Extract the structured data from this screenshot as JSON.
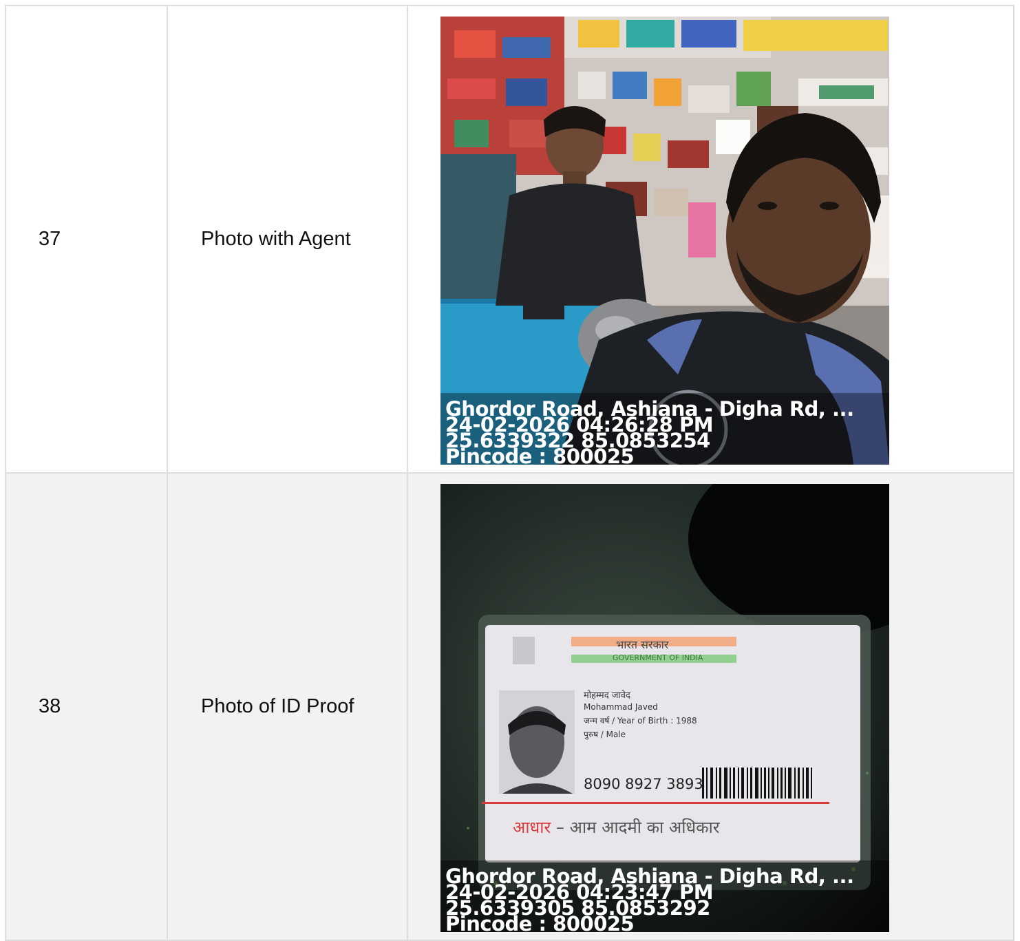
{
  "rows": [
    {
      "number": "37",
      "label": "Photo with Agent",
      "photo": {
        "subject": "selfie-in-pharmacy",
        "location": "Ghordor Road, Ashiana - Digha Rd, ...",
        "datetime": "24-02-2026 04:26:28 PM",
        "coords": "25.6339322 85.0853254",
        "pincode": "Pincode : 800025"
      }
    },
    {
      "number": "38",
      "label": "Photo of ID Proof",
      "photo": {
        "subject": "aadhaar-card",
        "location": "Ghordor Road, Ashiana - Digha Rd, ...",
        "datetime": "24-02-2026 04:23:47 PM",
        "coords": "25.6339305 85.0853292",
        "pincode": "Pincode : 800025",
        "card": {
          "header_hi": "भारत सरकार",
          "header_en": "GOVERNMENT OF INDIA",
          "name_hi": "मोहम्मद जावेद",
          "name_en": "Mohammad Javed",
          "birth": "जन्म वर्ष / Year of Birth : 1988",
          "gender": "पुरुष / Male",
          "number": "8090 8927 3893",
          "tagline_red": "आधार",
          "tagline": "– आम आदमी का अधिकार"
        }
      }
    }
  ],
  "colors": {
    "border": "#dedede",
    "row_alt_bg": "#f2f2f2",
    "card_red": "#d83a3a"
  }
}
